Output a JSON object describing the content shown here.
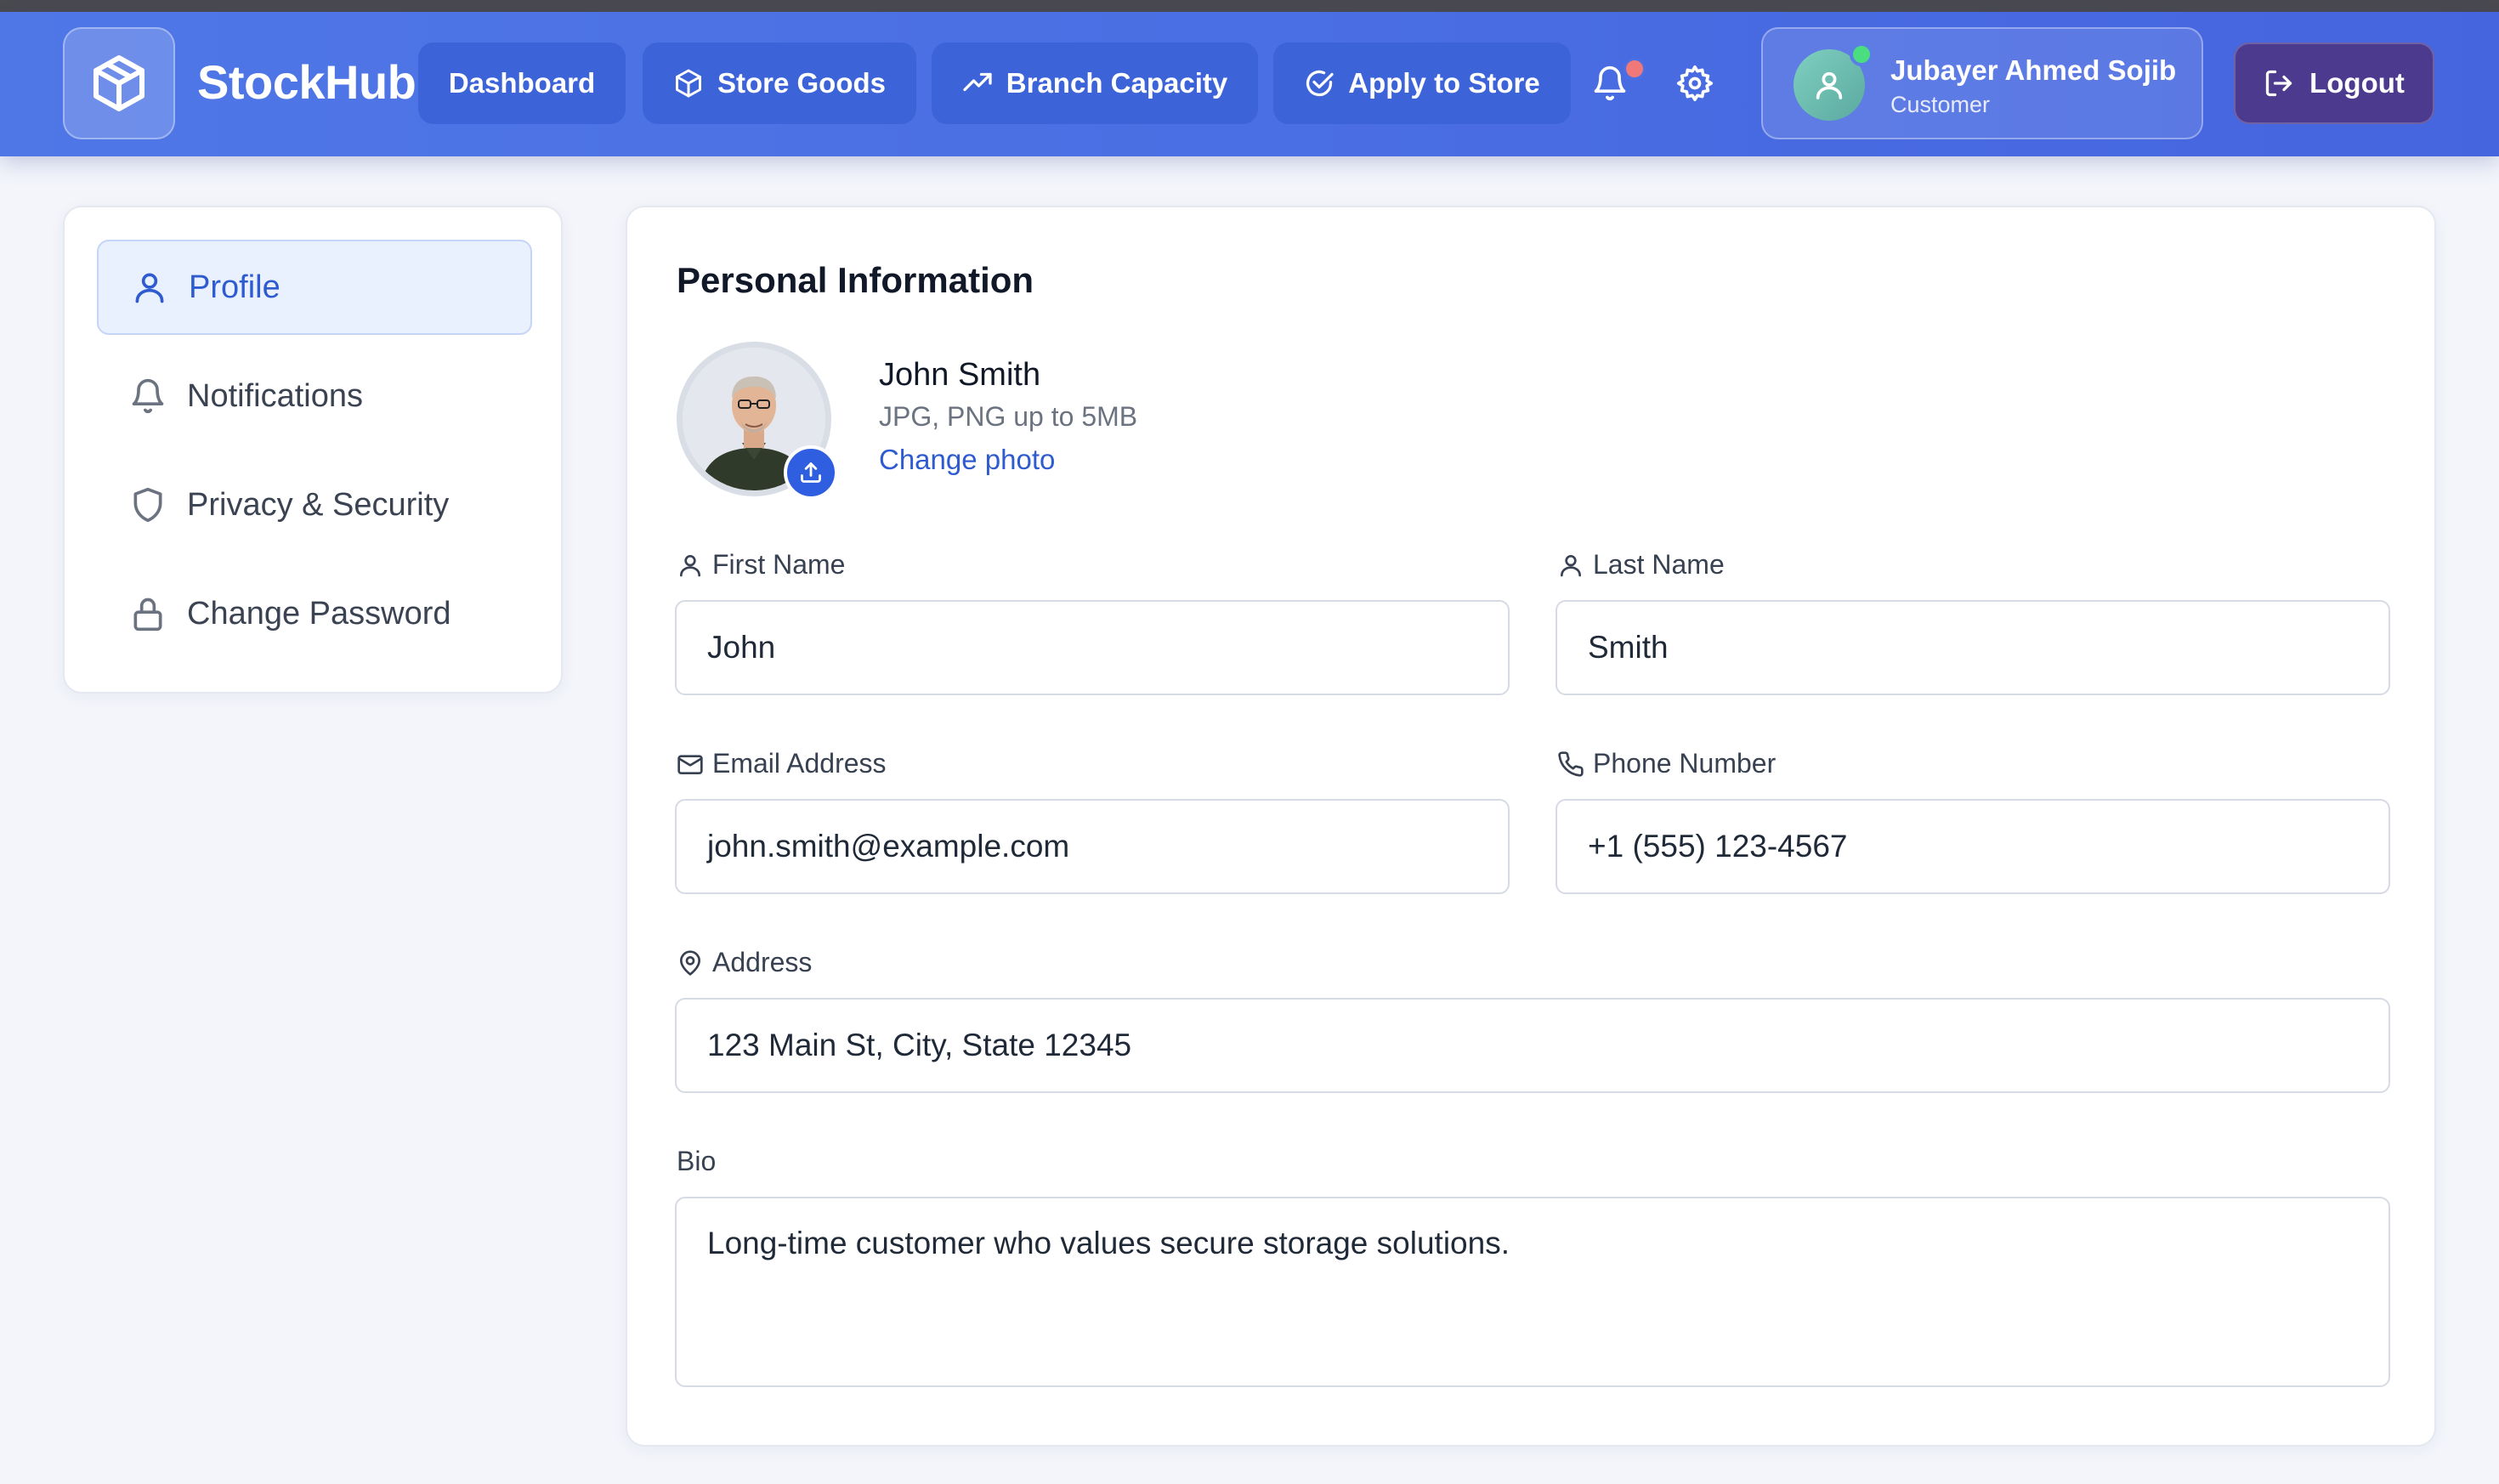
{
  "app": {
    "brand": "StockHub"
  },
  "nav": {
    "items": [
      {
        "label": "Dashboard",
        "icon": "none"
      },
      {
        "label": "Store Goods",
        "icon": "package-icon"
      },
      {
        "label": "Branch Capacity",
        "icon": "trending-up-icon"
      },
      {
        "label": "Apply to Store",
        "icon": "check-circle-icon"
      }
    ],
    "logout_label": "Logout"
  },
  "user": {
    "name": "Jubayer Ahmed Sojib",
    "role": "Customer",
    "online": true
  },
  "notifications": {
    "has_unread": true
  },
  "sidebar": {
    "items": [
      {
        "label": "Profile",
        "icon": "user-icon",
        "active": true
      },
      {
        "label": "Notifications",
        "icon": "bell-icon",
        "active": false
      },
      {
        "label": "Privacy & Security",
        "icon": "shield-icon",
        "active": false
      },
      {
        "label": "Change Password",
        "icon": "lock-icon",
        "active": false
      }
    ]
  },
  "profile": {
    "section_title": "Personal Information",
    "photo": {
      "name": "John Smith",
      "hint": "JPG, PNG up to 5MB",
      "change_label": "Change photo"
    },
    "fields": {
      "first_name": {
        "label": "First Name",
        "value": "John"
      },
      "last_name": {
        "label": "Last Name",
        "value": "Smith"
      },
      "email": {
        "label": "Email Address",
        "value": "john.smith@example.com"
      },
      "phone": {
        "label": "Phone Number",
        "value": "+1 (555) 123-4567"
      },
      "address": {
        "label": "Address",
        "value": "123 Main St, City, State 12345"
      },
      "bio": {
        "label": "Bio",
        "value": "Long-time customer who values secure storage solutions."
      }
    }
  },
  "colors": {
    "accent": "#2f5bd0",
    "navbar": "#4a6ee3",
    "logout": "#4b3a8e",
    "notif_dot": "#f07878",
    "online": "#4ade80"
  }
}
